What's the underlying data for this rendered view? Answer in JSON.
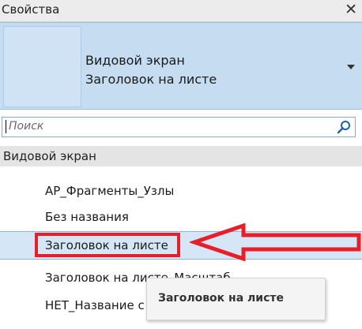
{
  "window": {
    "title": "Свойства",
    "close_symbol": "✕"
  },
  "type_selector": {
    "family": "Видовой экран",
    "type": "Заголовок на листе"
  },
  "search": {
    "placeholder": "Поиск",
    "value": ""
  },
  "list": {
    "group_header": "Видовой экран",
    "items": [
      {
        "label": "АР_Фрагменты_Узлы"
      },
      {
        "label": "Без названия"
      },
      {
        "label": "Заголовок на листе",
        "selected": true
      },
      {
        "label": "Заголовок на листе_Масштаб"
      },
      {
        "label": "НЕТ_Название с"
      }
    ]
  },
  "tooltip": {
    "text": "Заголовок на листе"
  },
  "colors": {
    "selector_bg": "#c6ddf1",
    "selected_row_bg": "#d5e7f7",
    "annotation_red": "#e81f2a",
    "search_icon": "#1f5fa8"
  }
}
